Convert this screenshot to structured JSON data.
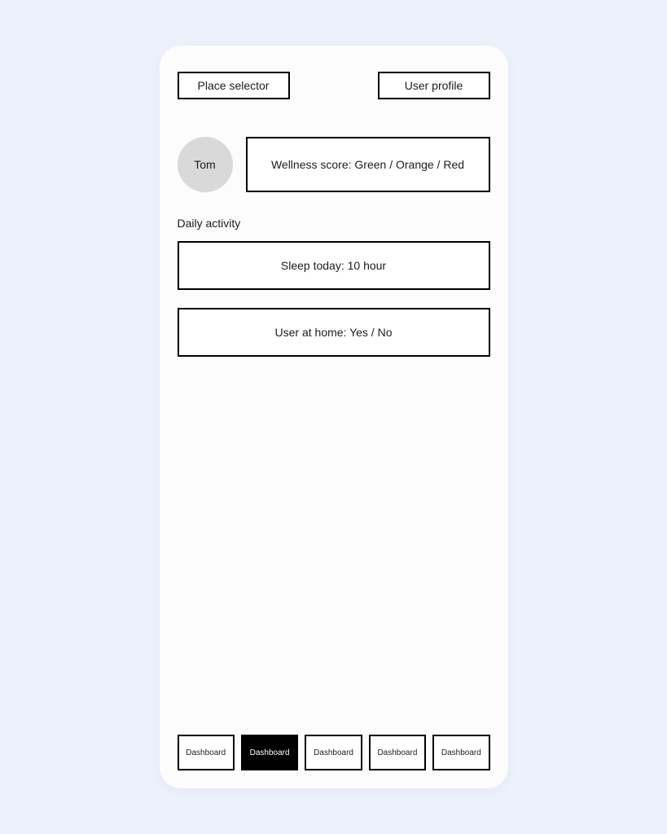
{
  "header": {
    "place_selector": "Place selector",
    "user_profile": "User profile"
  },
  "user": {
    "name": "Tom",
    "wellness": "Wellness score: Green / Orange / Red"
  },
  "daily": {
    "label": "Daily activity",
    "sleep": "Sleep today: 10 hour",
    "home": "User at home: Yes / No"
  },
  "nav": {
    "items": [
      {
        "label": "Dashboard",
        "active": false
      },
      {
        "label": "Dashboard",
        "active": true
      },
      {
        "label": "Dashboard",
        "active": false
      },
      {
        "label": "Dashboard",
        "active": false
      },
      {
        "label": "Dashboard",
        "active": false
      }
    ]
  }
}
